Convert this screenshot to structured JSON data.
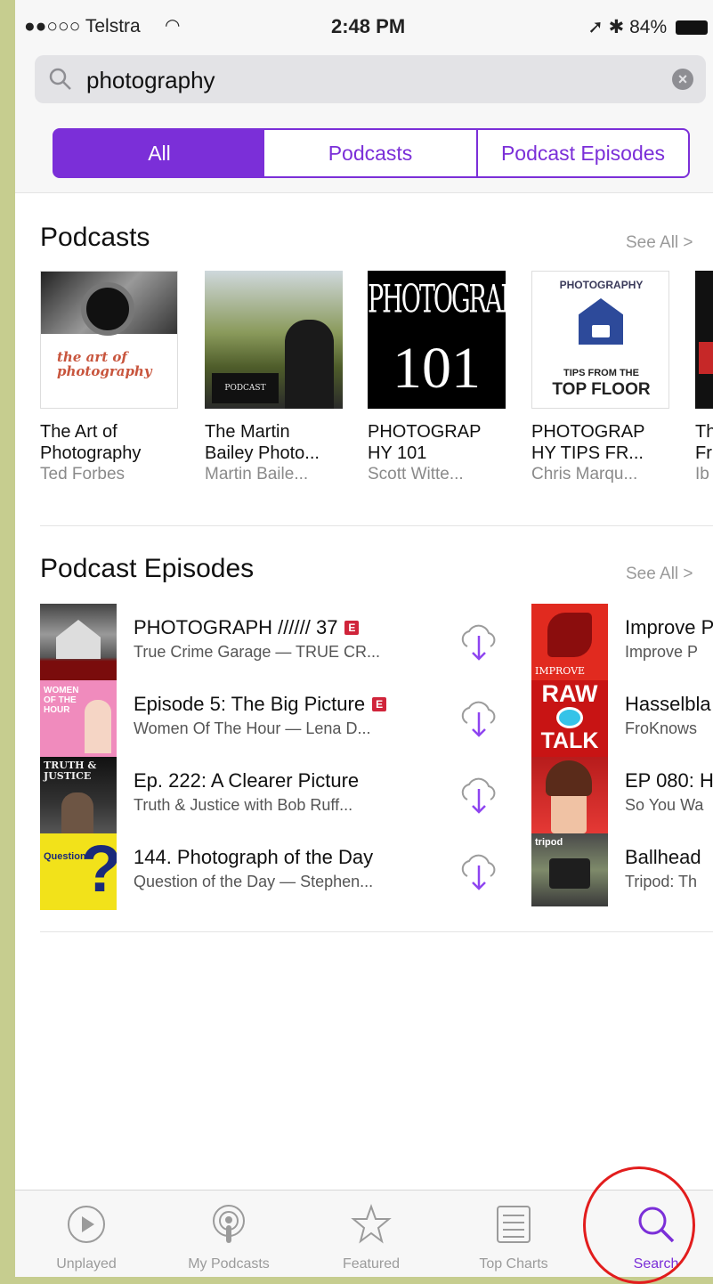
{
  "status": {
    "carrier": "●●○○○ Telstra",
    "time": "2:48 PM",
    "battery": "84%"
  },
  "search": {
    "query": "photography"
  },
  "segments": [
    {
      "label": "All",
      "active": true
    },
    {
      "label": "Podcasts",
      "active": false
    },
    {
      "label": "Podcast Episodes",
      "active": false
    }
  ],
  "podcasts_section": {
    "title": "Podcasts",
    "see_all": "See All >",
    "items": [
      {
        "title1": "The Art of",
        "title2": "Photography",
        "author": "Ted Forbes",
        "art_text": "the art of photography"
      },
      {
        "title1": "The Martin",
        "title2": "Bailey Photo...",
        "author": "Martin Baile...",
        "art_text": "PODCAST"
      },
      {
        "title1": "PHOTOGRAP",
        "title2": "HY 101",
        "author": "Scott Witte...",
        "art_text1": "PHOTOGRAPHY",
        "art_text2": "101"
      },
      {
        "title1": "PHOTOGRAP",
        "title2": "HY TIPS FR...",
        "author": "Chris Marqu...",
        "art_text1": "PHOTOGRAPHY",
        "art_text2": "TIPS FROM THE",
        "art_text3": "TOP FLOOR"
      },
      {
        "title1": "Th",
        "title2": "Fr",
        "author": "Ib"
      }
    ]
  },
  "episodes_section": {
    "title": "Podcast Episodes",
    "see_all": "See All >",
    "left": [
      {
        "title": "PHOTOGRAPH ////// 37",
        "explicit": "E",
        "subtitle": "True Crime Garage — TRUE CR..."
      },
      {
        "title": "Episode 5: The Big Picture",
        "explicit": "E",
        "subtitle": "Women Of The Hour — Lena D..."
      },
      {
        "title": "Ep. 222: A Clearer Picture",
        "subtitle": "Truth & Justice with Bob Ruff..."
      },
      {
        "title": "144. Photograph of the Day",
        "subtitle": "Question of the Day — Stephen..."
      }
    ],
    "right": [
      {
        "title": "Improve P",
        "subtitle": "Improve P",
        "thumb_text": "IMPROVE"
      },
      {
        "title": "Hasselbla",
        "subtitle": "FroKnows",
        "thumb_text1": "RAW",
        "thumb_text2": "TALK"
      },
      {
        "title": "EP 080: H",
        "subtitle": "So You Wa"
      },
      {
        "title": "Ballhead",
        "subtitle": "Tripod: Th",
        "thumb_text": "tripod"
      }
    ],
    "left_thumb_texts": {
      "t2": "WOMEN OF THE HOUR",
      "t3": "TRUTH & JUSTICE",
      "t4": "Question"
    }
  },
  "tabs": [
    {
      "label": "Unplayed",
      "icon": "play-circle-icon",
      "active": false
    },
    {
      "label": "My Podcasts",
      "icon": "podcast-icon",
      "active": false
    },
    {
      "label": "Featured",
      "icon": "star-icon",
      "active": false
    },
    {
      "label": "Top Charts",
      "icon": "list-icon",
      "active": false
    },
    {
      "label": "Search",
      "icon": "search-icon",
      "active": true
    }
  ],
  "colors": {
    "accent": "#7b2fd8",
    "highlight_circle": "#e21d1d",
    "explicit": "#d0243a",
    "frame": "#c6cd8f"
  }
}
